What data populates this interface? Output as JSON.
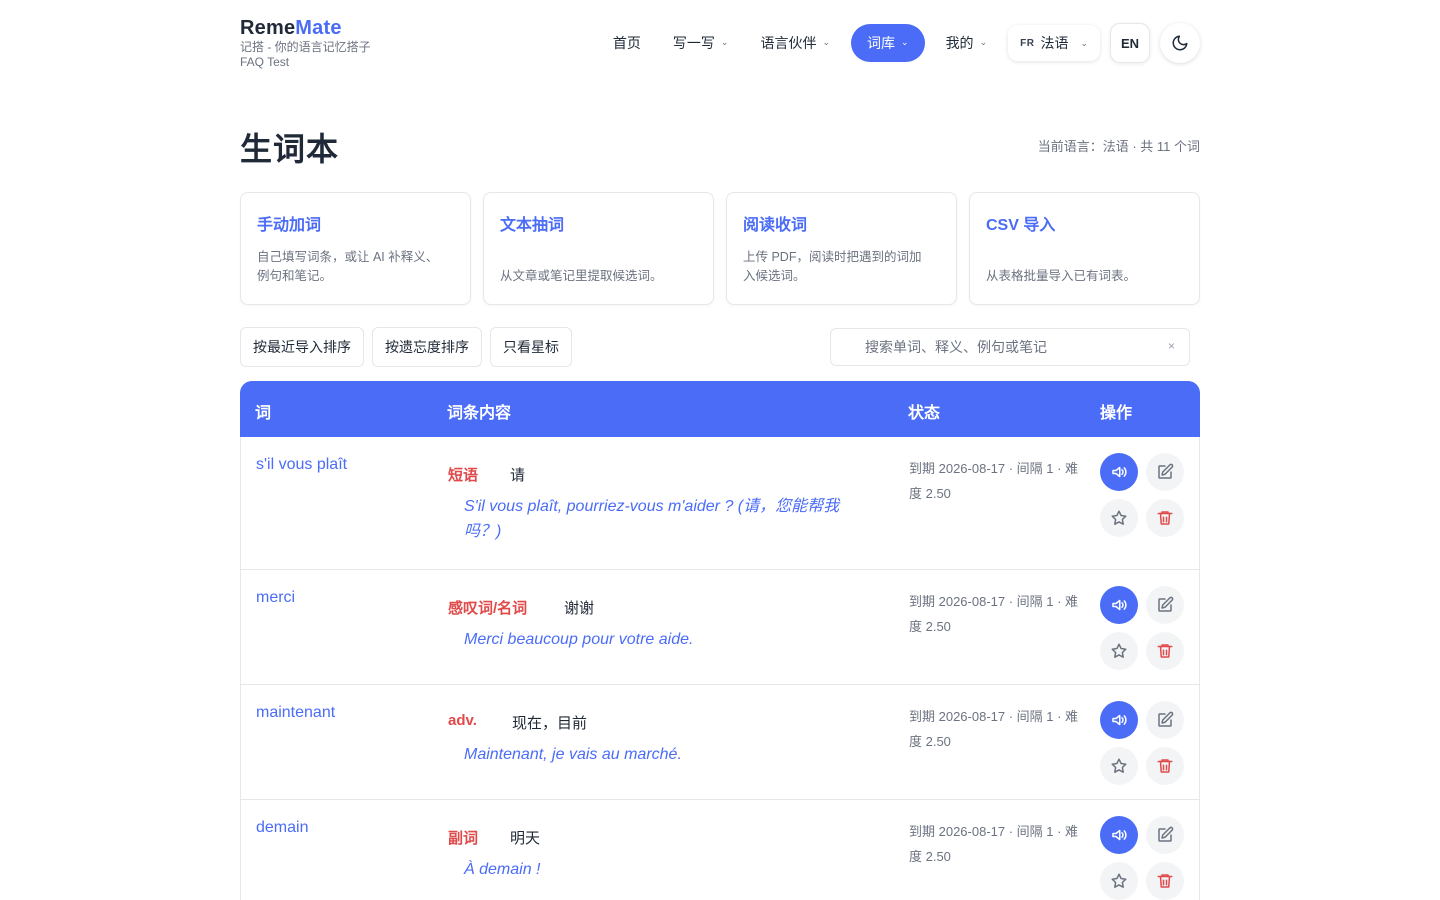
{
  "brand": {
    "name_a": "Reme",
    "name_b": "Mate",
    "tagline": "记搭 - 你的语言记忆搭子",
    "sub": "FAQ Test"
  },
  "nav": {
    "items": [
      {
        "label": "首页"
      },
      {
        "label": "写一写"
      },
      {
        "label": "语言伙伴"
      },
      {
        "label": "词库"
      },
      {
        "label": "我的"
      }
    ],
    "lang_code": "FR",
    "lang_label": "法语",
    "ui_lang": "EN"
  },
  "page": {
    "title": "生词本",
    "meta": "当前语言：法语 · 共 11 个词"
  },
  "cards": [
    {
      "title": "手动加词",
      "desc": "自己填写词条，或让 AI 补释义、例句和笔记。"
    },
    {
      "title": "文本抽词",
      "desc": "从文章或笔记里提取候选词。"
    },
    {
      "title": "阅读收词",
      "desc": "上传 PDF，阅读时把遇到的词加入候选词。"
    },
    {
      "title": "CSV 导入",
      "desc": "从表格批量导入已有词表。"
    }
  ],
  "toolbar": {
    "sort_recent": "按最近导入排序",
    "sort_forget": "按遗忘度排序",
    "starred_only": "只看星标",
    "search_placeholder": "搜索单词、释义、例句或笔记",
    "clear": "×"
  },
  "table": {
    "headers": {
      "word": "词",
      "content": "词条内容",
      "status": "状态",
      "actions": "操作"
    },
    "rows": [
      {
        "word": "s'il vous plaît",
        "pos": "短语",
        "meaning": "请",
        "example": "S'il vous plaît, pourriez-vous m'aider ? (请，您能帮我吗？)",
        "status": "到期 2026-08-17 · 间隔 1 · 难度 2.50"
      },
      {
        "word": "merci",
        "pos": "感叹词/名词",
        "meaning": "谢谢",
        "example": "Merci beaucoup pour votre aide.",
        "status": "到期 2026-08-17 · 间隔 1 · 难度 2.50"
      },
      {
        "word": "maintenant",
        "pos": "adv.",
        "meaning": "现在，目前",
        "example": "Maintenant, je vais au marché.",
        "status": "到期 2026-08-17 · 间隔 1 · 难度 2.50"
      },
      {
        "word": "demain",
        "pos": "副词",
        "meaning": "明天",
        "example": "À demain !",
        "status": "到期 2026-08-17 · 间隔 1 · 难度 2.50"
      }
    ]
  },
  "colors": {
    "accent": "#4a6cf7",
    "pos": "#e04a4a",
    "muted": "#6b7280"
  },
  "icons": [
    "chevron-down-icon",
    "moon-icon",
    "speaker-icon",
    "edit-icon",
    "star-icon",
    "trash-icon"
  ]
}
